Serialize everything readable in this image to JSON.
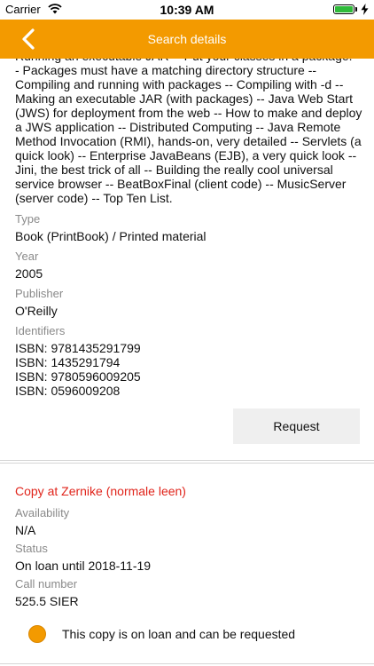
{
  "status_bar": {
    "carrier": "Carrier",
    "time": "10:39 AM",
    "battery_level": 1.0,
    "battery_color": "#2fbb3a"
  },
  "nav": {
    "title": "Search details",
    "back_icon": "chevron-left-icon",
    "color": "#f39a00"
  },
  "summary_text": "Running an executable JAR -- Put your classes in a package! -- Packages must have a matching directory structure -- Compiling and running with packages -- Compiling with -d -- Making an executable JAR (with packages) -- Java Web Start (JWS) for deployment from the web -- How to make and deploy a JWS application -- Distributed Computing -- Java Remote Method Invocation (RMI), hands-on, very detailed -- Servlets (a quick look) -- Enterprise JavaBeans (EJB), a very quick look -- Jini, the best trick of all -- Building the really cool universal service browser -- BeatBoxFinal (client code) -- MusicServer (server code) -- Top Ten List.",
  "details": {
    "type": {
      "label": "Type",
      "value": "Book (PrintBook) / Printed material"
    },
    "year": {
      "label": "Year",
      "value": "2005"
    },
    "publisher": {
      "label": "Publisher",
      "value": "O'Reilly"
    },
    "identifiers": {
      "label": "Identifiers",
      "values": [
        "ISBN: 9781435291799",
        "ISBN: 1435291794",
        "ISBN: 9780596009205",
        "ISBN: 0596009208"
      ]
    }
  },
  "request_button": "Request",
  "copy": {
    "title": "Copy at Zernike (normale leen)",
    "title_color": "#e0241b",
    "availability": {
      "label": "Availability",
      "value": "N/A"
    },
    "status": {
      "label": "Status",
      "value": "On loan until 2018-11-19"
    },
    "call_number": {
      "label": "Call number",
      "value": "525.5 SIER"
    },
    "loan_option": "This copy is on loan and can be requested"
  }
}
